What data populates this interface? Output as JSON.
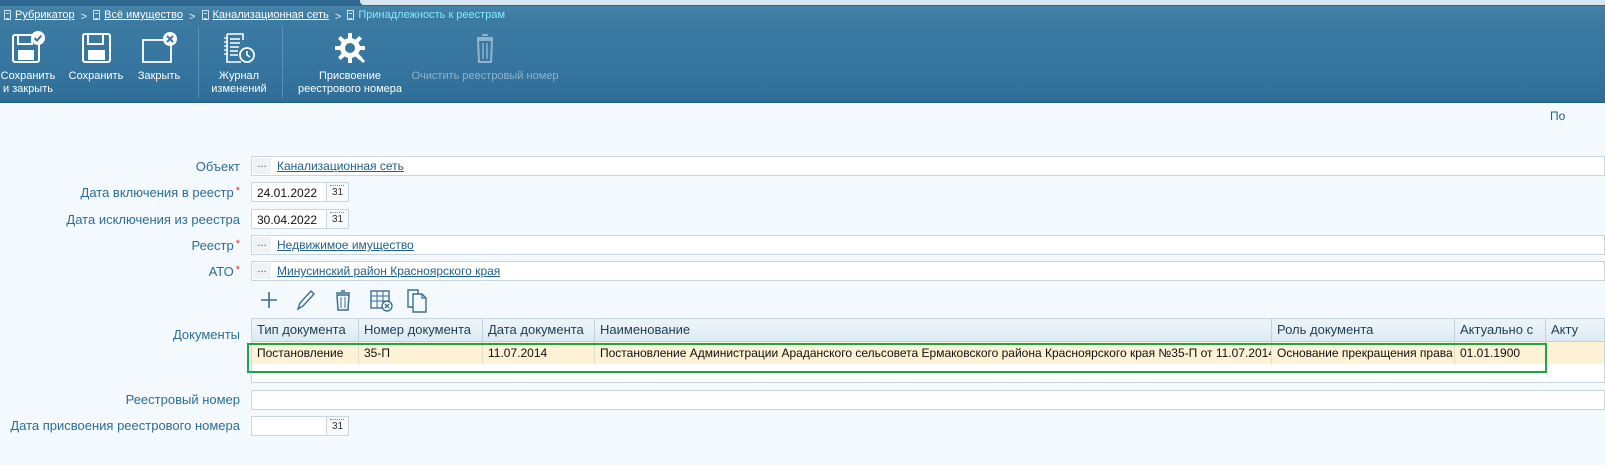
{
  "breadcrumb": {
    "items": [
      "Рубрикатор",
      "Всё имущество",
      "Канализационная сеть"
    ],
    "current": "Принадлежность к реестрам",
    "separator": ">"
  },
  "toolbar": {
    "save_close": "Сохранить\nи закрыть",
    "save": "Сохранить",
    "close": "Закрыть",
    "journal": "Журнал\nизменений",
    "assign": "Присвоение\nреестрового номера",
    "clear": "Очистить реестровый номер"
  },
  "right_cut_text": "По",
  "form": {
    "object": {
      "label": "Объект",
      "value": "Канализационная сеть"
    },
    "date_in": {
      "label": "Дата включения в реестр",
      "value": "24.01.2022",
      "required": "*"
    },
    "date_out": {
      "label": "Дата исключения из реестра",
      "value": "30.04.2022"
    },
    "registry": {
      "label": "Реестр",
      "value": "Недвижимое имущество",
      "required": "*"
    },
    "ato": {
      "label": "АТО",
      "value": "Минусинский район Красноярского края",
      "required": "*"
    },
    "documents_label": "Документы",
    "reg_number": {
      "label": "Реестровый номер",
      "value": ""
    },
    "reg_date": {
      "label": "Дата присвоения реестрового номера",
      "value": ""
    },
    "dots": "...",
    "cal": "31"
  },
  "grid": {
    "columns": [
      "Тип документа",
      "Номер документа",
      "Дата документа",
      "Наименование",
      "Роль документа",
      "Актуально с",
      "Акту"
    ],
    "rows": [
      [
        "Постановление",
        "35-П",
        "11.07.2014",
        "Постановление Администрации Араданского сельсовета Ермаковского района Красноярского края №35-П от 11.07.2014",
        "Основание прекращения права",
        "01.01.1900",
        ""
      ]
    ]
  },
  "colors": {
    "header": "#3676a0",
    "label": "#2c6d98",
    "link": "#1f5f8e",
    "selected_row": "#fdf1d6",
    "highlight": "#1fa34a",
    "required": "#e0302c"
  }
}
